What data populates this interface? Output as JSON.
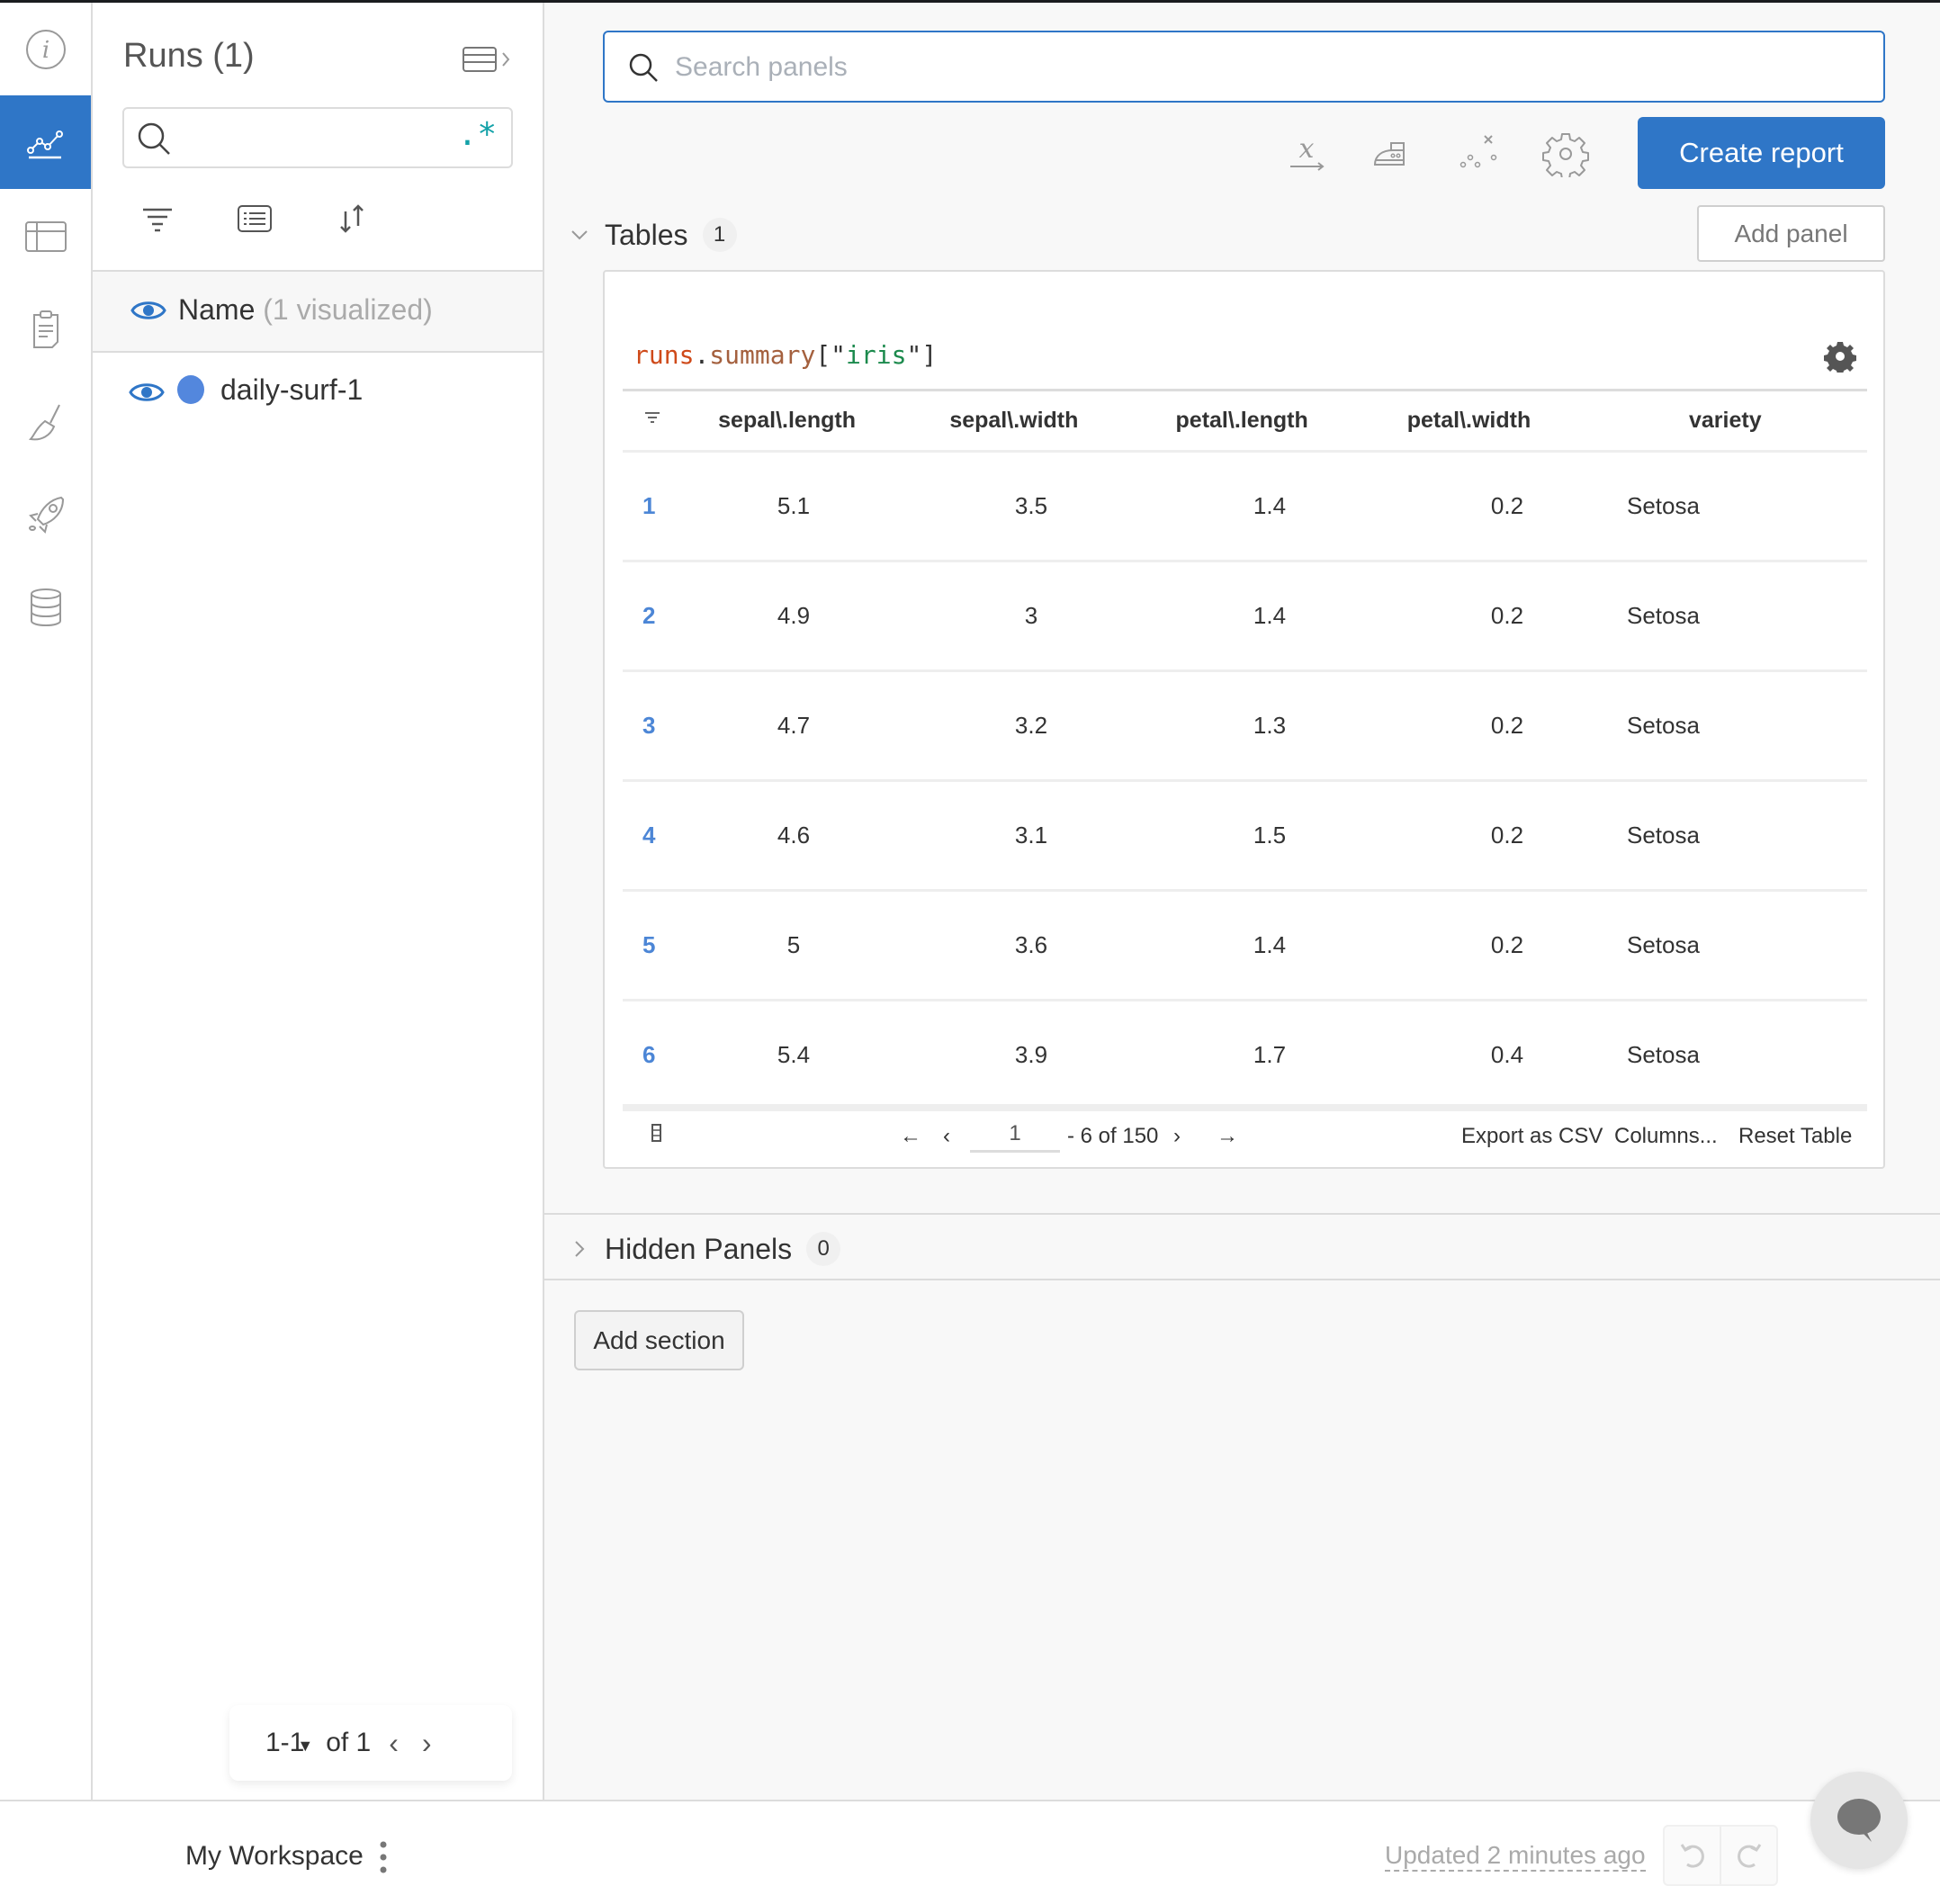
{
  "rail": {
    "items": [
      {
        "name": "overview",
        "icon": "info-icon",
        "active": false
      },
      {
        "name": "workspace",
        "icon": "line-chart-icon",
        "active": true
      },
      {
        "name": "runs-table",
        "icon": "table-icon",
        "active": false
      },
      {
        "name": "reports",
        "icon": "clipboard-icon",
        "active": false
      },
      {
        "name": "sweeps",
        "icon": "broom-icon",
        "active": false
      },
      {
        "name": "launch",
        "icon": "rocket-icon",
        "active": false
      },
      {
        "name": "artifacts",
        "icon": "database-icon",
        "active": false
      }
    ]
  },
  "runs": {
    "title": "Runs (1)",
    "search_value": "",
    "regex_label": ".*",
    "header_name": "Name",
    "header_count": "(1 visualized)",
    "items": [
      {
        "name": "daily-surf-1",
        "color": "#5387dd"
      }
    ],
    "pager": {
      "range": "1-1",
      "of": "of 1"
    }
  },
  "main": {
    "search_placeholder": "Search panels",
    "search_value": "",
    "create_report_label": "Create report",
    "add_panel_label": "Add panel",
    "add_section_label": "Add section",
    "sections": [
      {
        "title": "Tables",
        "count": "1",
        "expanded": true
      },
      {
        "title": "Hidden Panels",
        "count": "0",
        "expanded": false
      }
    ],
    "panel": {
      "expr_runs": "runs",
      "expr_dot": ".",
      "expr_summary": "summary",
      "expr_open": "[\"",
      "expr_key": "iris",
      "expr_close": "\"]",
      "columns": [
        "sepal\\.length",
        "sepal\\.width",
        "petal\\.length",
        "petal\\.width",
        "variety"
      ],
      "rows": [
        {
          "idx": "1",
          "cells": [
            "5.1",
            "3.5",
            "1.4",
            "0.2",
            "Setosa"
          ]
        },
        {
          "idx": "2",
          "cells": [
            "4.9",
            "3",
            "1.4",
            "0.2",
            "Setosa"
          ]
        },
        {
          "idx": "3",
          "cells": [
            "4.7",
            "3.2",
            "1.3",
            "0.2",
            "Setosa"
          ]
        },
        {
          "idx": "4",
          "cells": [
            "4.6",
            "3.1",
            "1.5",
            "0.2",
            "Setosa"
          ]
        },
        {
          "idx": "5",
          "cells": [
            "5",
            "3.6",
            "1.4",
            "0.2",
            "Setosa"
          ]
        },
        {
          "idx": "6",
          "cells": [
            "5.4",
            "3.9",
            "1.7",
            "0.4",
            "Setosa"
          ]
        }
      ],
      "pagination": {
        "page": "1",
        "range_text": "- 6 of 150"
      },
      "export_label": "Export as CSV",
      "columns_label": "Columns...",
      "reset_label": "Reset Table"
    }
  },
  "footer": {
    "workspace_name": "My Workspace",
    "updated_text": "Updated 2 minutes ago"
  },
  "colors": {
    "accent": "#2f76c7",
    "run_color": "#5387dd",
    "regex": "#13a1a8"
  }
}
